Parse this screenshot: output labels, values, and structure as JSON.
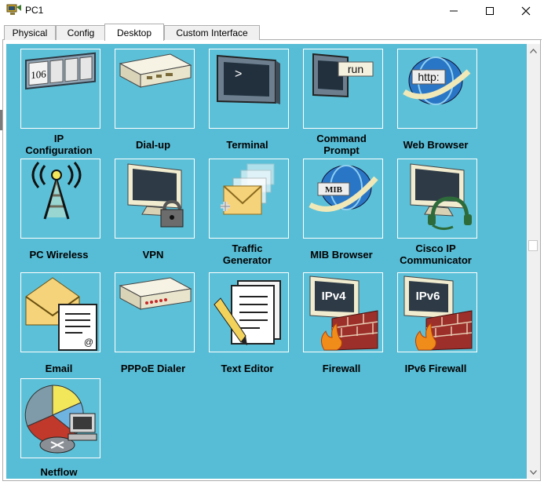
{
  "window": {
    "title": "PC1"
  },
  "tabs": [
    {
      "label": "Physical",
      "active": false
    },
    {
      "label": "Config",
      "active": false
    },
    {
      "label": "Desktop",
      "active": true
    },
    {
      "label": "Custom Interface",
      "active": false
    }
  ],
  "desktop": {
    "background_color": "#57bcd5",
    "apps": [
      {
        "label": "IP\nConfiguration",
        "icon": "ip-configuration-icon",
        "badge": "106"
      },
      {
        "label": "Dial-up",
        "icon": "modem-icon"
      },
      {
        "label": "Terminal",
        "icon": "terminal-icon",
        "badge": ">"
      },
      {
        "label": "Command\nPrompt",
        "icon": "command-prompt-icon",
        "badge": "run"
      },
      {
        "label": "Web Browser",
        "icon": "web-browser-icon",
        "badge": "http:"
      },
      {
        "label": "PC Wireless",
        "icon": "wireless-tower-icon"
      },
      {
        "label": "VPN",
        "icon": "vpn-lock-icon"
      },
      {
        "label": "Traffic\nGenerator",
        "icon": "traffic-generator-icon"
      },
      {
        "label": "MIB Browser",
        "icon": "mib-browser-icon",
        "badge": "MIB"
      },
      {
        "label": "Cisco IP\nCommunicator",
        "icon": "ip-communicator-icon"
      },
      {
        "label": "Email",
        "icon": "email-icon",
        "badge": "@"
      },
      {
        "label": "PPPoE Dialer",
        "icon": "pppoe-dialer-icon"
      },
      {
        "label": "Text Editor",
        "icon": "text-editor-icon"
      },
      {
        "label": "Firewall",
        "icon": "firewall-icon",
        "badge": "IPv4"
      },
      {
        "label": "IPv6 Firewall",
        "icon": "ipv6-firewall-icon",
        "badge": "IPv6"
      },
      {
        "label": "Netflow",
        "icon": "netflow-icon"
      }
    ]
  }
}
